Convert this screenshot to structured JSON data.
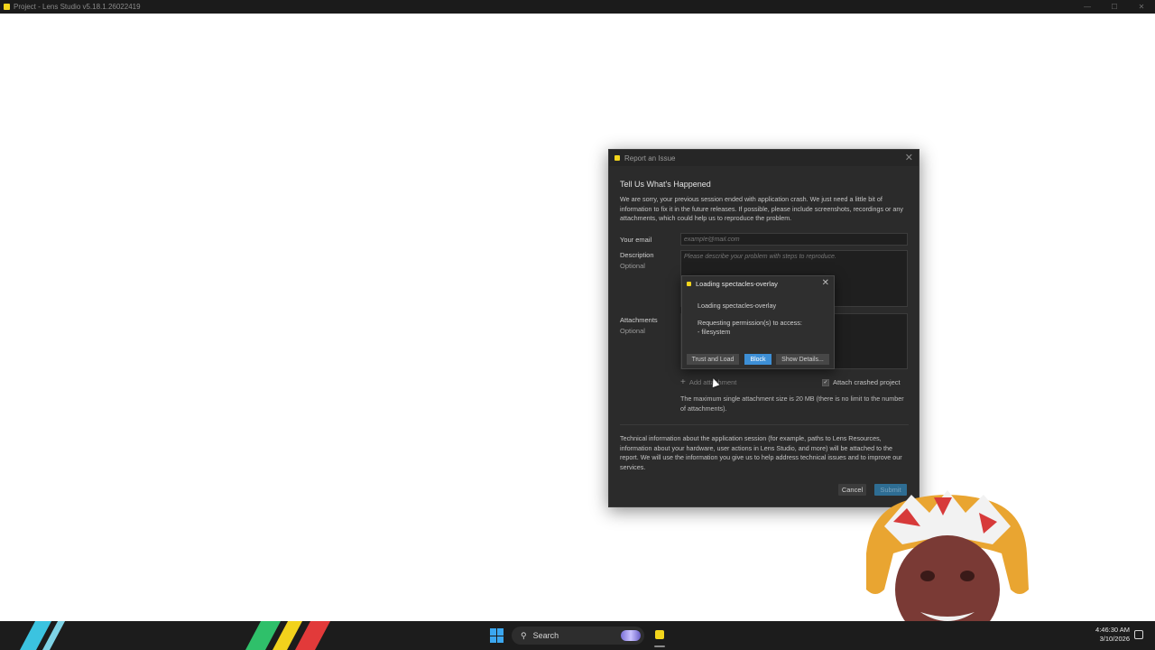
{
  "window": {
    "title": "Project - Lens Studio v5.18.1.26022419"
  },
  "report_dialog": {
    "title": "Report an Issue",
    "heading": "Tell Us What's Happened",
    "intro": "We are sorry, your previous session ended with application crash. We just need a little bit of information to fix it in the future releases. If possible, please include screenshots, recordings or any attachments, which could help us to reproduce the problem.",
    "email_label": "Your email",
    "email_placeholder": "example@mail.com",
    "description_label": "Description",
    "description_optional": "Optional",
    "description_placeholder": "Please describe your problem with steps to reproduce.",
    "attachments_label": "Attachments",
    "attachments_optional": "Optional",
    "add_attachment": "Add attachment",
    "attach_crashed_project": "Attach crashed project",
    "attach_crashed_project_checked": true,
    "size_note": "The maximum single attachment size is 20 MB (there is no limit to the number of attachments).",
    "technical_info": "Technical information about the application session (for example, paths to Lens Resources, information about your hardware, user actions in Lens Studio, and more) will be attached to the report. We will use the information you give us to help address technical issues and to improve our services.",
    "cancel": "Cancel",
    "submit": "Submit"
  },
  "loading_popup": {
    "title": "Loading spectacles-overlay",
    "status": "Loading spectacles-overlay",
    "request_line": "Requesting permission(s) to access:",
    "permission_item": "- filesystem",
    "trust_button": "Trust and Load",
    "block_button": "Block",
    "details_button": "Show Details..."
  },
  "taskbar": {
    "search_label": "Search",
    "time": "4:46:30 AM",
    "date": "3/10/2026"
  },
  "colors": {
    "accent": "#3d8fd6",
    "app_icon": "#f3d51c",
    "dialog_bg": "#2b2b2b"
  }
}
